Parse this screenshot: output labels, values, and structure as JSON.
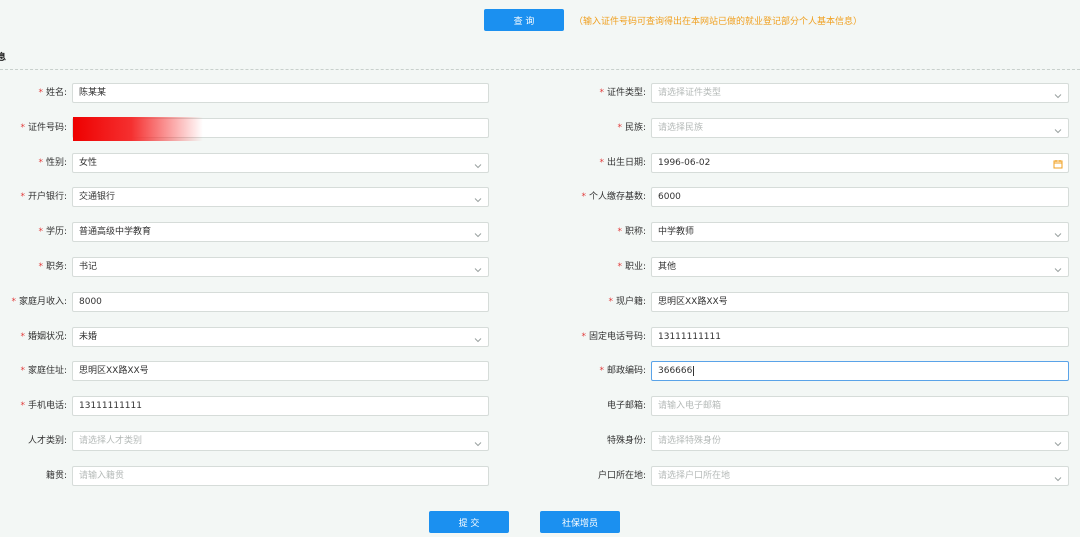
{
  "top": {
    "query_label": "查 询",
    "hint": "（输入证件号码可查询得出在本网站已做的就业登记部分个人基本信息）"
  },
  "section": {
    "title": "信息"
  },
  "form": {
    "rows": [
      {
        "left": {
          "label": "姓名:",
          "required": "*",
          "value": "陈某某",
          "type": "text"
        },
        "right": {
          "label": "证件类型:",
          "required": "*",
          "value": "请选择证件类型",
          "type": "select-placeholder"
        }
      },
      {
        "left": {
          "label": "证件号码:",
          "required": "*",
          "value": "",
          "type": "redacted"
        },
        "right": {
          "label": "民族:",
          "required": "*",
          "value": "请选择民族",
          "type": "select-placeholder"
        }
      },
      {
        "left": {
          "label": "性别:",
          "required": "*",
          "value": "女性",
          "type": "select"
        },
        "right": {
          "label": "出生日期:",
          "required": "*",
          "value": "1996-06-02",
          "type": "date"
        }
      },
      {
        "left": {
          "label": "开户银行:",
          "required": "*",
          "value": "交通银行",
          "type": "select"
        },
        "right": {
          "label": "个人缴存基数:",
          "required": "*",
          "value": "6000",
          "type": "text"
        }
      },
      {
        "left": {
          "label": "学历:",
          "required": "*",
          "value": "普通高级中学教育",
          "type": "select"
        },
        "right": {
          "label": "职称:",
          "required": "*",
          "value": "中学教师",
          "type": "select"
        }
      },
      {
        "left": {
          "label": "职务:",
          "required": "*",
          "value": "书记",
          "type": "select"
        },
        "right": {
          "label": "职业:",
          "required": "*",
          "value": "其他",
          "type": "select"
        }
      },
      {
        "left": {
          "label": "家庭月收入:",
          "required": "*",
          "value": "8000",
          "type": "text"
        },
        "right": {
          "label": "现户籍:",
          "required": "*",
          "value": "思明区XX路XX号",
          "type": "text"
        }
      },
      {
        "left": {
          "label": "婚姻状况:",
          "required": "*",
          "value": "未婚",
          "type": "select"
        },
        "right": {
          "label": "固定电话号码:",
          "required": "*",
          "value": "13111111111",
          "type": "text"
        }
      },
      {
        "left": {
          "label": "家庭住址:",
          "required": "*",
          "value": "思明区XX路XX号",
          "type": "text"
        },
        "right": {
          "label": "邮政编码:",
          "required": "*",
          "value": "366666",
          "type": "active"
        }
      },
      {
        "left": {
          "label": "手机电话:",
          "required": "*",
          "value": "13111111111",
          "type": "text"
        },
        "right": {
          "label": "电子邮箱:",
          "required": "",
          "value": "请输入电子邮箱",
          "type": "placeholder"
        }
      },
      {
        "left": {
          "label": "人才类别:",
          "required": "",
          "value": "请选择人才类别",
          "type": "select-placeholder"
        },
        "right": {
          "label": "特殊身份:",
          "required": "",
          "value": "请选择特殊身份",
          "type": "select-placeholder"
        }
      },
      {
        "left": {
          "label": "籍贯:",
          "required": "",
          "value": "请输入籍贯",
          "type": "placeholder"
        },
        "right": {
          "label": "户口所在地:",
          "required": "",
          "value": "请选择户口所在地",
          "type": "select-placeholder"
        }
      }
    ]
  },
  "actions": {
    "submit_label": "提 交",
    "social_security_label": "社保增员"
  },
  "colors": {
    "primary": "#1b90f0",
    "hint": "#f0a020",
    "required": "#e23c3c",
    "background": "#f3f7f5",
    "active_border": "#5aa3e8",
    "redaction": "#ee0000"
  },
  "icons": {
    "select": "chevron-down-icon",
    "date": "calendar-icon"
  }
}
